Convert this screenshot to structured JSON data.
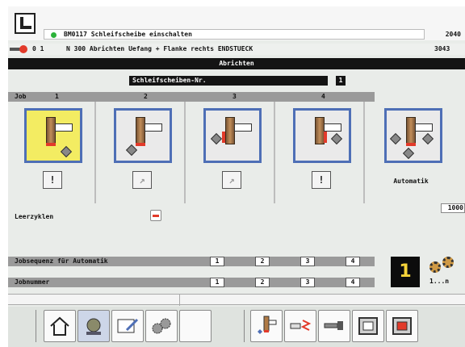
{
  "header": {
    "message": "BM0117 Schleifscheibe einschalten",
    "message_code": "2040",
    "program_line": "N 300  Abrichten Uefang + Flanke rechts ENDSTUECK",
    "program_prefix": "0 1",
    "program_code": "3043"
  },
  "title": "Abrichten",
  "field": {
    "label": "Schleifscheiben-Nr.",
    "value": "1"
  },
  "jobs": {
    "header_label": "Job",
    "numbers": [
      "1",
      "2",
      "3",
      "4"
    ],
    "auto_label": "Automatik",
    "mini_icons": [
      "!",
      "↗",
      "↗",
      "!"
    ]
  },
  "leerzyklen": {
    "label": "Leerzyklen",
    "value": "1000"
  },
  "sequence": {
    "label": "Jobsequenz für Automatik",
    "values": [
      "1",
      "2",
      "3",
      "4"
    ]
  },
  "jobnummer": {
    "label": "Jobnummer",
    "values": [
      "1",
      "2",
      "3",
      "4"
    ]
  },
  "counter": {
    "value": "1",
    "range_label": "1...n"
  },
  "toolbar": {
    "icons": [
      "home-icon",
      "dressing-tool-icon",
      "edit-screen-icon",
      "gears-icon",
      "wheel-dressing-icon",
      "dresser-zigzag-icon",
      "spindle-icon",
      "frame-icon",
      "frame-red-icon"
    ]
  },
  "colors": {
    "selected_tile": "#f3ec62",
    "tile_border": "#4e6fb6",
    "accent_red": "#e23a2a",
    "counter_text": "#f5d33a"
  }
}
